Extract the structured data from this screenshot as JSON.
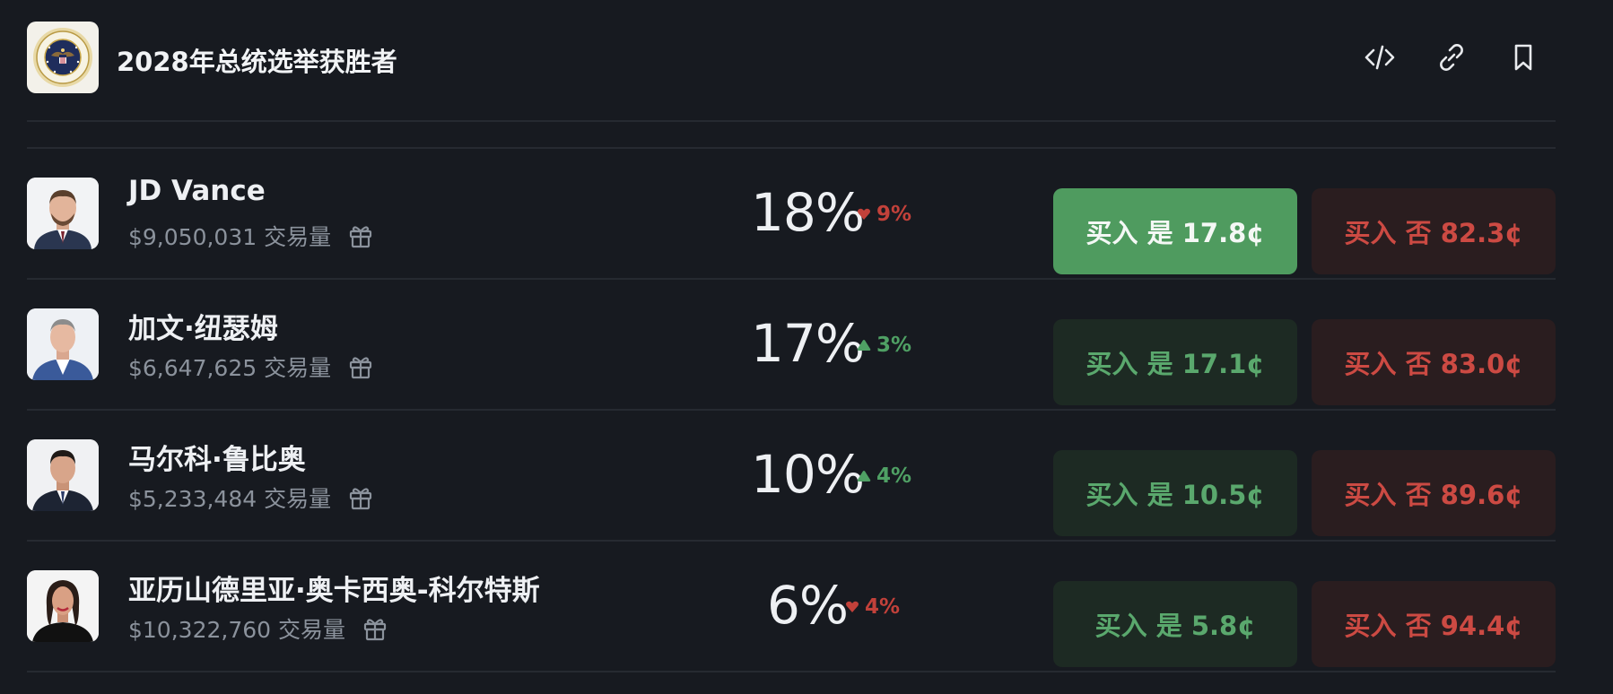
{
  "header": {
    "title": "2028年总统选举获胜者",
    "icons": [
      "seal-icon",
      "embed-code-icon",
      "link-icon",
      "bookmark-icon"
    ]
  },
  "rows": [
    {
      "name": "JD Vance",
      "volume": "$9,050,031 交易量",
      "percent": "18%",
      "change": "9%",
      "change_direction": "down",
      "yes_label": "买入 是 17.8¢",
      "no_label": "买入 否 82.3¢",
      "yes_highlighted": true
    },
    {
      "name": "加文·纽瑟姆",
      "volume": "$6,647,625 交易量",
      "percent": "17%",
      "change": "3%",
      "change_direction": "up",
      "yes_label": "买入 是 17.1¢",
      "no_label": "买入 否 83.0¢",
      "yes_highlighted": false
    },
    {
      "name": "马尔科·鲁比奥",
      "volume": "$5,233,484 交易量",
      "percent": "10%",
      "change": "4%",
      "change_direction": "up",
      "yes_label": "买入 是 10.5¢",
      "no_label": "买入 否 89.6¢",
      "yes_highlighted": false
    },
    {
      "name": "亚历山德里亚·奥卡西奥-科尔特斯",
      "volume": "$10,322,760 交易量",
      "percent": "6%",
      "change": "4%",
      "change_direction": "down",
      "yes_label": "买入 是 5.8¢",
      "no_label": "买入 否 94.4¢",
      "yes_highlighted": false
    }
  ],
  "colors": {
    "background": "#171a20",
    "up": "#4fa064",
    "down": "#c2413a",
    "yes_active": "#4f9b5f",
    "yes_bg": "#1d2a23",
    "no_bg": "#2a1d1f"
  }
}
